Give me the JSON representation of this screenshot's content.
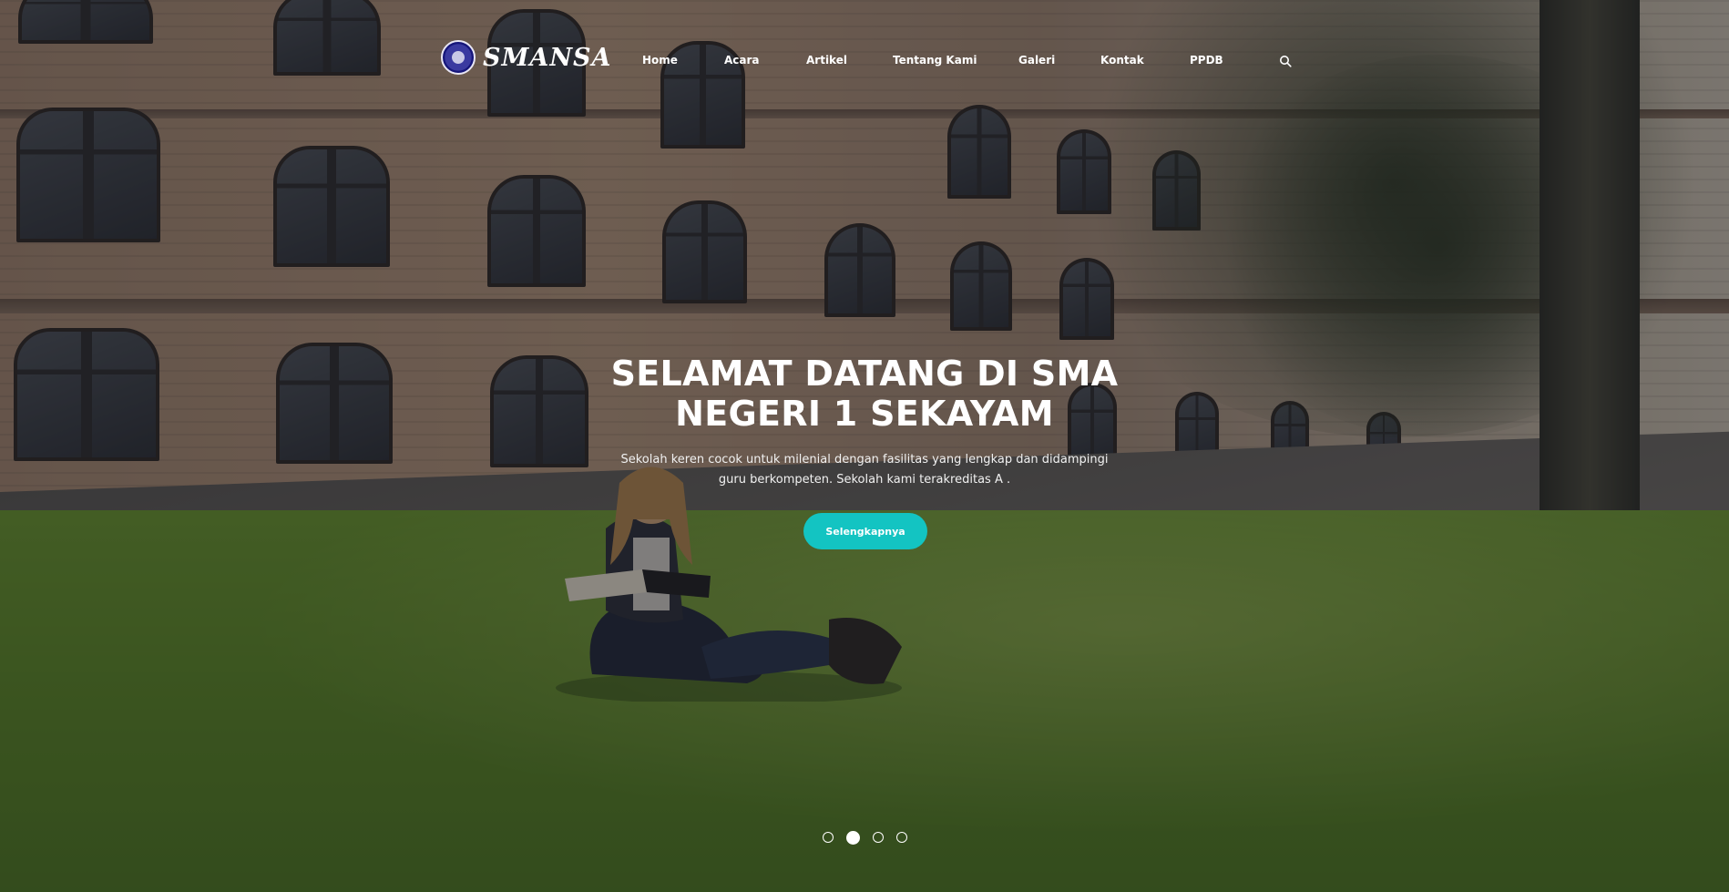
{
  "brand": {
    "name": "SMANSA"
  },
  "nav": {
    "items": [
      {
        "label": "Home"
      },
      {
        "label": "Acara"
      },
      {
        "label": "Artikel"
      },
      {
        "label": "Tentang Kami"
      },
      {
        "label": "Galeri"
      },
      {
        "label": "Kontak"
      },
      {
        "label": "PPDB"
      }
    ],
    "search_icon": "search-icon"
  },
  "hero": {
    "title_line1": "SELAMAT DATANG DI SMA",
    "title_line2": "NEGERI 1 SEKAYAM",
    "description_line1": "Sekolah keren cocok untuk milenial dengan fasilitas yang lengkap dan didampingi",
    "description_line2": "guru berkompeten. Sekolah kami terakreditas A .",
    "cta_label": "Selengkapnya",
    "cta_color": "#13c4c2"
  },
  "carousel": {
    "slide_count": 4,
    "active_index": 1
  }
}
